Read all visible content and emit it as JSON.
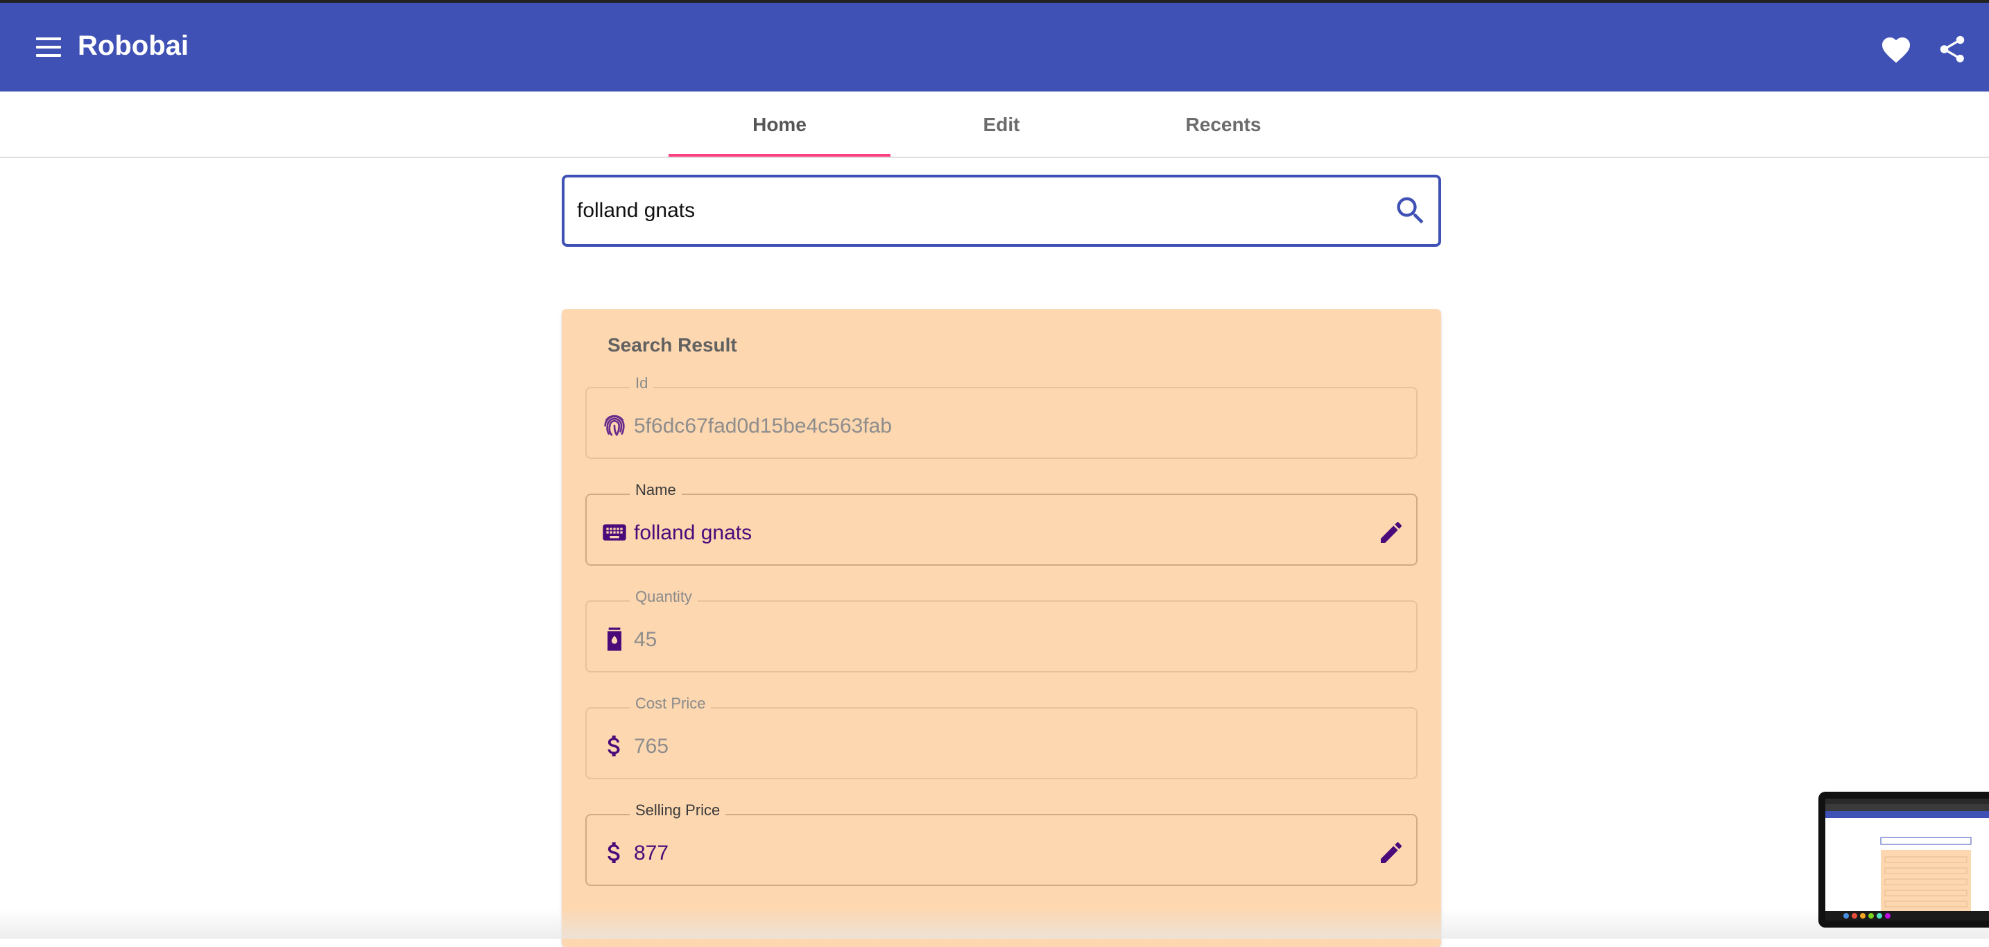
{
  "app": {
    "title": "Robobai"
  },
  "tabs": [
    {
      "label": "Home"
    },
    {
      "label": "Edit"
    },
    {
      "label": "Recents"
    }
  ],
  "search": {
    "value": "folland gnats"
  },
  "result": {
    "title": "Search Result",
    "fields": [
      {
        "label": "Id",
        "value": "5f6dc67fad0d15be4c563fab",
        "icon": "fingerprint-icon"
      },
      {
        "label": "Name",
        "value": "folland gnats",
        "icon": "keyboard-icon"
      },
      {
        "label": "Quantity",
        "value": "45",
        "icon": "bottle-icon"
      },
      {
        "label": "Cost Price",
        "value": "765",
        "icon": "dollar-icon"
      },
      {
        "label": "Selling Price",
        "value": "877",
        "icon": "dollar-icon"
      }
    ]
  },
  "colors": {
    "appbar": "#3f51b5",
    "tab_indicator": "#ff4081",
    "card": "#fdd7b0",
    "icon": "#4a0a7a"
  }
}
